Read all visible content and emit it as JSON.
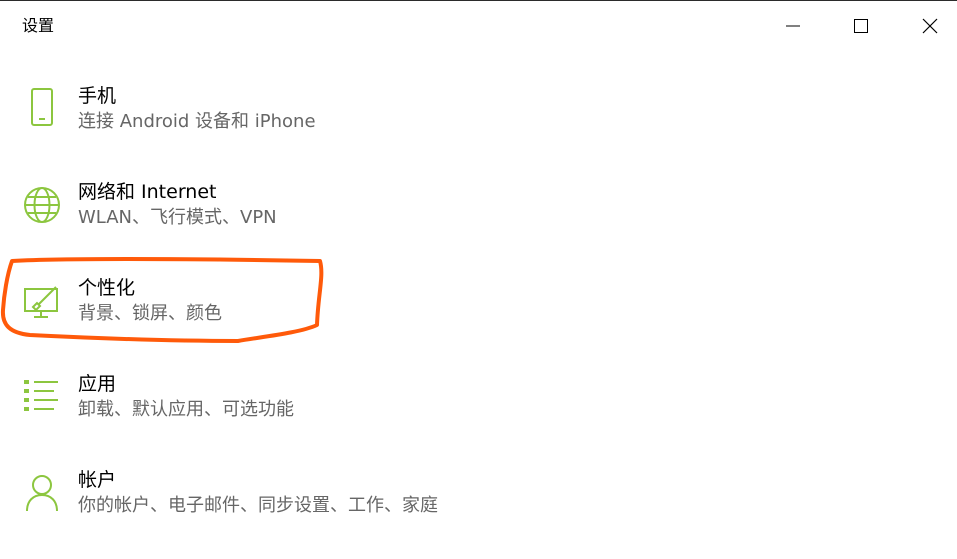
{
  "window": {
    "title": "设置",
    "accent_color": "#8cc63f",
    "annotation_color": "#ff5a0a"
  },
  "categories": [
    {
      "id": "phone",
      "label": "手机",
      "description": "连接 Android 设备和 iPhone",
      "icon": "phone-icon"
    },
    {
      "id": "network",
      "label": "网络和 Internet",
      "description": "WLAN、飞行模式、VPN",
      "icon": "globe-icon"
    },
    {
      "id": "personalization",
      "label": "个性化",
      "description": "背景、锁屏、颜色",
      "icon": "personalization-icon"
    },
    {
      "id": "apps",
      "label": "应用",
      "description": "卸载、默认应用、可选功能",
      "icon": "apps-list-icon"
    },
    {
      "id": "accounts",
      "label": "帐户",
      "description": "你的帐户、电子邮件、同步设置、工作、家庭",
      "icon": "person-icon"
    }
  ]
}
